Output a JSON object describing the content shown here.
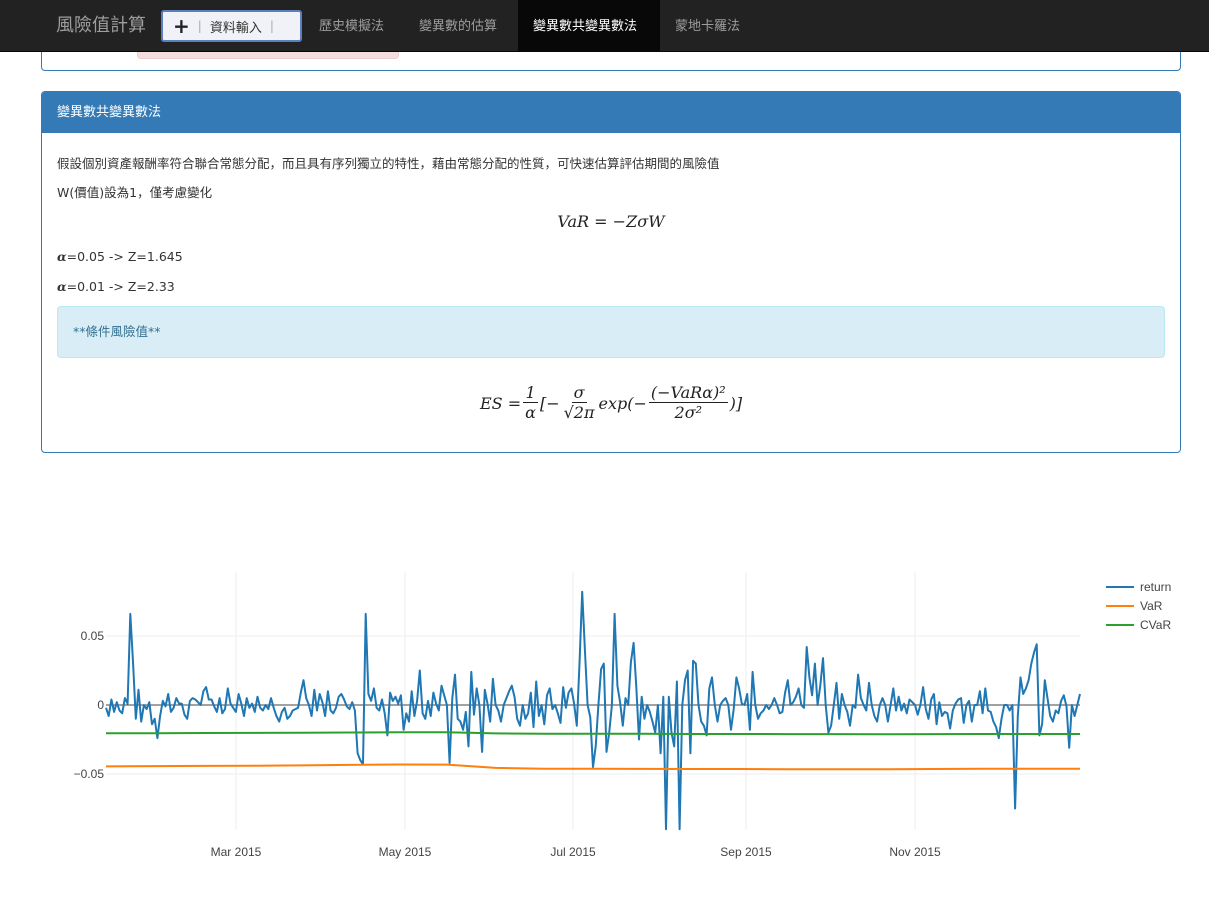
{
  "navbar": {
    "brand": "風險值計算",
    "data_button_label": "資料輸入",
    "items": [
      {
        "label": "歷史模擬法",
        "active": false
      },
      {
        "label": "變異數的估算",
        "active": false
      },
      {
        "label": "變異數共變異數法",
        "active": true
      },
      {
        "label": "蒙地卡羅法",
        "active": false
      }
    ]
  },
  "panel": {
    "title": "變異數共變異數法",
    "description": "假設個別資產報酬率符合聯合常態分配，而且具有序列獨立的特性，藉由常態分配的性質，可快速估算評估期間的風險值",
    "w_note": "W(價值)設為1，僅考慮變化",
    "var_formula": "VaR = −ZσW",
    "alpha_symbol": "α",
    "alpha_lines": [
      "=0.05 -> Z=1.645",
      "=0.01 -> Z=2.33"
    ],
    "info_box": "**條件風險值**",
    "es_formula": {
      "lhs": "ES =",
      "one": "1",
      "alpha": "α",
      "bracket_open": "[−",
      "sigma": "σ",
      "sqrt_two_pi": "√2π",
      "exp_open": "exp(−",
      "num": "(−VaRα)²",
      "den": "2σ²",
      "close": ")]"
    }
  },
  "chart_data": {
    "type": "line",
    "x_tick_labels": [
      "Mar 2015",
      "May 2015",
      "Jul 2015",
      "Sep 2015",
      "Nov 2015"
    ],
    "y_tick_labels": [
      "0.05",
      "0",
      "−0.05"
    ],
    "ylim": [
      -0.09,
      0.095
    ],
    "grid": true,
    "legend_placement": "top-right",
    "series_colors": {
      "return": "#1f77b4",
      "VaR": "#ff7f0e",
      "CVaR": "#2ca02c"
    },
    "series": [
      {
        "name": "return",
        "values": [
          -0.002,
          -0.008,
          0.004,
          -0.005,
          0.002,
          -0.004,
          -0.006,
          0.005,
          0.001,
          0.066,
          0.03,
          -0.01,
          0.011,
          -0.012,
          0.0,
          -0.003,
          0.002,
          -0.014,
          -0.01,
          -0.024,
          -0.008,
          0.003,
          -0.001,
          0.008,
          -0.005,
          -0.002,
          0.005,
          0.001,
          0.001,
          -0.007,
          -0.01,
          0.003,
          0.005,
          0.004,
          0.002,
          0.0,
          0.01,
          0.013,
          0.004,
          0.004,
          -0.001,
          -0.005,
          0.005,
          -0.006,
          -0.003,
          0.012,
          0.001,
          -0.002,
          -0.005,
          0.008,
          0.001,
          -0.008,
          0.005,
          -0.002,
          0.001,
          -0.005,
          0.006,
          -0.002,
          -0.004,
          0.0,
          -0.003,
          0.005,
          -0.002,
          -0.008,
          -0.012,
          -0.005,
          -0.002,
          -0.01,
          -0.008,
          -0.004,
          -0.003,
          -0.002,
          0.009,
          0.018,
          0.005,
          0.0,
          -0.008,
          0.011,
          -0.004,
          0.008,
          0.002,
          -0.008,
          0.01,
          -0.004,
          -0.006,
          -0.002,
          0.006,
          0.008,
          0.004,
          -0.001,
          -0.003,
          0.002,
          -0.004,
          -0.035,
          -0.04,
          -0.043,
          0.066,
          0.008,
          0.003,
          0.012,
          -0.002,
          -0.004,
          0.004,
          -0.006,
          -0.022,
          0.009,
          0.003,
          0.006,
          0.001,
          0.007,
          -0.018,
          -0.006,
          -0.012,
          0.01,
          -0.008,
          0.003,
          0.025,
          -0.006,
          -0.01,
          0.003,
          -0.008,
          0.009,
          0.001,
          -0.004,
          0.014,
          0.007,
          0.0,
          -0.042,
          0.005,
          0.022,
          -0.01,
          -0.012,
          -0.018,
          -0.005,
          -0.03,
          0.024,
          -0.007,
          0.012,
          0.0,
          -0.034,
          0.011,
          0.001,
          -0.012,
          0.019,
          0.0,
          -0.004,
          -0.012,
          0.0,
          0.005,
          0.01,
          0.014,
          0.006,
          -0.01,
          -0.015,
          0.0,
          -0.01,
          -0.006,
          0.009,
          -0.016,
          0.017,
          -0.008,
          0.0,
          -0.014,
          0.007,
          0.012,
          -0.003,
          0.0,
          -0.006,
          -0.013,
          0.013,
          -0.002,
          0.009,
          0.012,
          0.001,
          -0.015,
          0.03,
          0.082,
          0.04,
          0.0,
          -0.009,
          -0.045,
          -0.03,
          0.0,
          0.026,
          0.03,
          -0.034,
          -0.02,
          0.0,
          0.066,
          0.014,
          0.002,
          -0.015,
          0.005,
          0.0,
          0.031,
          0.045,
          0.013,
          -0.025,
          0.006,
          -0.01,
          0.0,
          -0.005,
          -0.012,
          -0.02,
          0.0,
          -0.035,
          0.006,
          -0.09,
          0.006,
          -0.02,
          -0.03,
          0.017,
          -0.09,
          0.0,
          0.018,
          0.025,
          -0.035,
          0.032,
          0.03,
          0.0,
          -0.012,
          -0.015,
          -0.022,
          0.012,
          0.02,
          0.0,
          -0.012,
          0.0,
          0.003,
          0.005,
          0.0,
          -0.018,
          -0.003,
          0.02,
          0.012,
          0.001,
          0.0,
          0.008,
          -0.018,
          0.024,
          0.0,
          -0.01,
          -0.006,
          -0.004,
          0.0,
          -0.003,
          0.0,
          0.005,
          0.0,
          -0.006,
          -0.005,
          0.009,
          0.018,
          0.0,
          0.002,
          0.006,
          0.012,
          0.0,
          -0.002,
          0.042,
          0.02,
          0.007,
          0.03,
          0.0,
          0.014,
          0.034,
          0.0,
          -0.02,
          -0.015,
          0.0,
          0.016,
          -0.01,
          0.008,
          0.0,
          -0.005,
          -0.015,
          0.0,
          -0.002,
          0.022,
          0.005,
          0.0,
          -0.004,
          0.016,
          0.0,
          -0.008,
          -0.012,
          0.0,
          0.005,
          0.0,
          -0.012,
          0.0,
          0.012,
          -0.004,
          0.006,
          -0.004,
          0.001,
          -0.006,
          0.004,
          0.002,
          0.0,
          -0.007,
          0.0,
          0.013,
          -0.003,
          -0.01,
          0.004,
          0.008,
          -0.014,
          0.002,
          -0.008,
          -0.005,
          -0.006,
          -0.017,
          -0.004,
          0.001,
          0.004,
          0.005,
          -0.013,
          0.0,
          0.003,
          -0.012,
          0.0,
          0.0,
          0.01,
          -0.006,
          0.012,
          -0.004,
          -0.005,
          -0.012,
          -0.016,
          -0.024,
          -0.01,
          0.0,
          0.0,
          -0.004,
          0.0,
          -0.075,
          -0.008,
          0.02,
          0.008,
          0.012,
          0.018,
          0.03,
          0.038,
          0.044,
          -0.022,
          -0.014,
          0.018,
          0.005,
          -0.008,
          -0.012,
          -0.004,
          -0.006,
          0.003,
          0.007,
          -0.001,
          -0.031,
          0.0,
          -0.008,
          0.0,
          0.008
        ]
      },
      {
        "name": "VaR",
        "values": [
          -0.0445,
          -0.0443,
          -0.0441,
          -0.044,
          -0.0438,
          -0.0434,
          -0.0431,
          -0.0432,
          -0.0456,
          -0.0462,
          -0.0462,
          -0.0463,
          -0.0464,
          -0.0464,
          -0.0465,
          -0.0465,
          -0.0466,
          -0.0464,
          -0.0462,
          -0.0462,
          -0.0462
        ]
      },
      {
        "name": "CVaR",
        "values": [
          -0.0205,
          -0.0204,
          -0.0203,
          -0.0202,
          -0.0201,
          -0.0199,
          -0.0198,
          -0.0198,
          -0.0206,
          -0.0209,
          -0.0209,
          -0.0209,
          -0.021,
          -0.021,
          -0.0211,
          -0.0211,
          -0.0212,
          -0.0211,
          -0.021,
          -0.021,
          -0.021
        ]
      }
    ]
  }
}
